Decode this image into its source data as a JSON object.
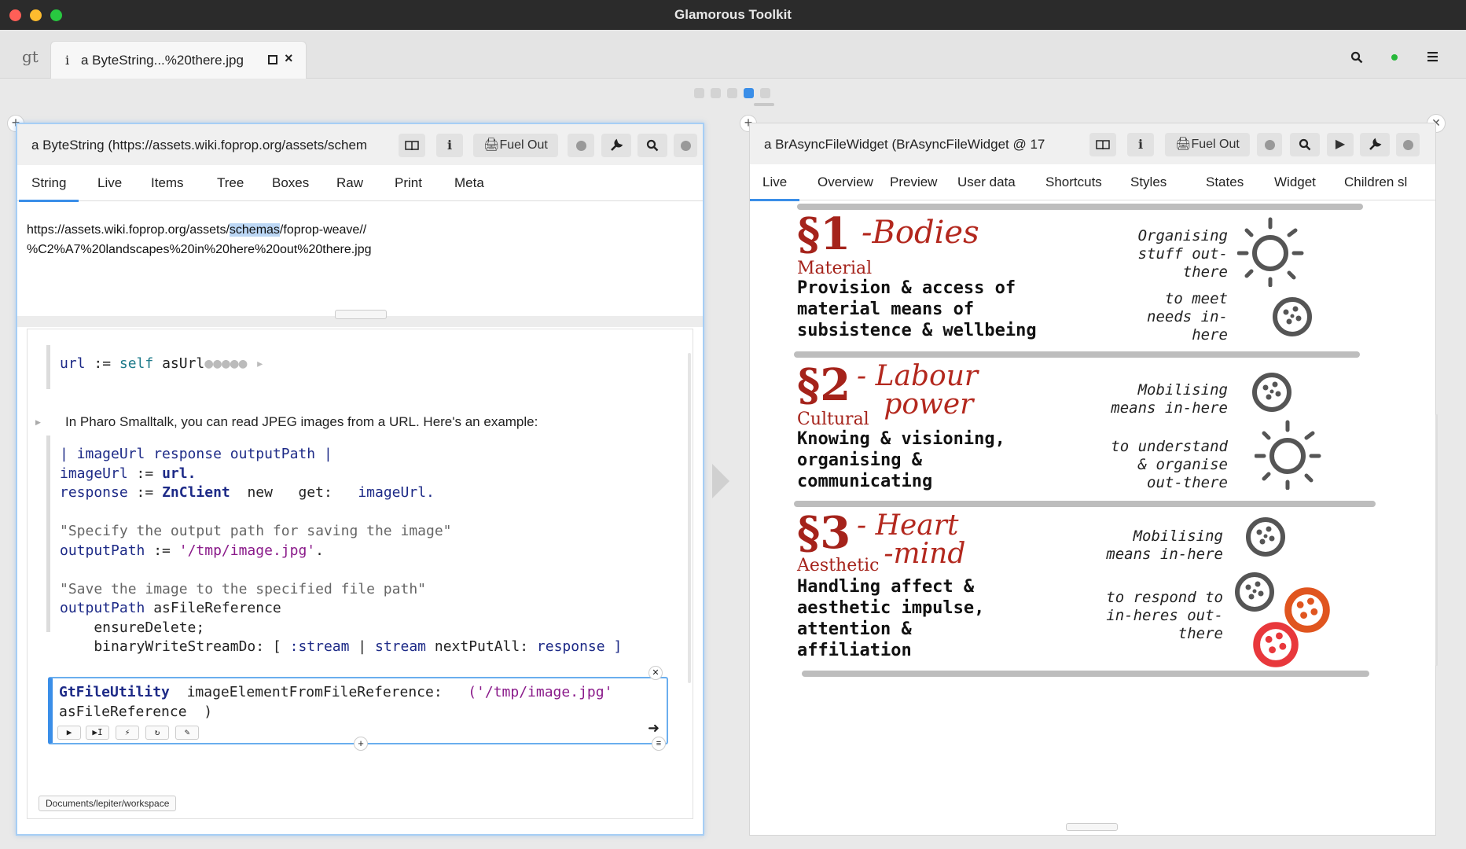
{
  "window": {
    "title": "Glamorous Toolkit"
  },
  "tabbar": {
    "logo": "gt",
    "tab": {
      "icon": "i",
      "label": "a ByteString...%20there.jpg"
    },
    "icons": [
      "search-icon",
      "status-dot-icon",
      "hamburger-menu-icon"
    ]
  },
  "left": {
    "title": "a ByteString (https://assets.wiki.foprop.org/assets/schem",
    "fuel_label": "Fuel Out",
    "tabs": [
      "String",
      "Live",
      "Items",
      "Tree",
      "Boxes",
      "Raw",
      "Print",
      "Meta"
    ],
    "url_pre": "https://assets.wiki.foprop.org/assets/",
    "url_hl": "schemas",
    "url_post": "/foprop-weave//",
    "url_line2": "%C2%A7%20landscapes%20in%20here%20out%20there.jpg",
    "snippet1": {
      "var": "url",
      "assign": " := ",
      "self": "self",
      "msg": " asUrl"
    },
    "prose": "In Pharo Smalltalk, you can read JPEG images from a URL. Here's an example:",
    "code": {
      "l1": "| imageUrl response outputPath |",
      "l2a": "imageUrl",
      "l2b": " := ",
      "l2c": "url.",
      "l3a": "response",
      "l3b": " := ",
      "l3c": "ZnClient",
      "l3d": "  new ",
      "l3e": "  get: ",
      "l3f": "  imageUrl.",
      "l4": "\"Specify the output path for saving the image\"",
      "l5a": "outputPath",
      "l5b": " := ",
      "l5c": "'/tmp/image.jpg'",
      "l5d": ".",
      "l6": "\"Save the image to the specified file path\"",
      "l7a": "outputPath",
      "l7b": " asFileReference",
      "l8": "    ensureDelete;",
      "l9a": "    binaryWriteStreamDo: [ ",
      "l9b": ":stream",
      "l9c": " | ",
      "l9d": "stream",
      "l9e": " nextPutAll: ",
      "l9f": "response",
      "l9g": " ]"
    },
    "editor": {
      "l1a": "GtFileUtility",
      "l1b": "  imageElementFromFileReference: ",
      "l1c": "  ('/tmp/image.jpg'",
      "l2a": "asFileReference",
      "l2b": "  )"
    },
    "path_chip": "Documents/lepiter/workspace"
  },
  "right": {
    "title": "a BrAsyncFileWidget (BrAsyncFileWidget @ 17",
    "fuel_label": "Fuel Out",
    "tabs": [
      "Live",
      "Overview",
      "Preview",
      "User data",
      "Shortcuts",
      "Styles",
      "States",
      "Widget",
      "Children sl"
    ],
    "image": {
      "s1": {
        "num": "§1",
        "name": "-Bodies",
        "sub": "Material",
        "desc": "Provision & access of\nmaterial means of\nsubsistence & wellbeing",
        "note1": "Organising\nstuff out-\nthere",
        "note2": "to meet\nneeds in-\nhere"
      },
      "s2": {
        "num": "§2",
        "name": "- Labour\n   power",
        "sub": "Cultural",
        "desc": "Knowing & visioning,\norganising &\ncommunicating",
        "note1": "Mobilising\nmeans in-here",
        "note2": "to understand\n& organise\nout-there"
      },
      "s3": {
        "num": "§3",
        "name": "- Heart\n   -mind",
        "sub": "Aesthetic",
        "desc": "Handling affect &\naesthetic impulse,\nattention &\naffiliation",
        "note1": "Mobilising\nmeans in-here",
        "note2": "to respond to\nin-heres out-\nthere"
      }
    }
  },
  "colors": {
    "accent": "#3a8ee8",
    "hand_red": "#a5231b",
    "selection": "#bcd7f5"
  }
}
